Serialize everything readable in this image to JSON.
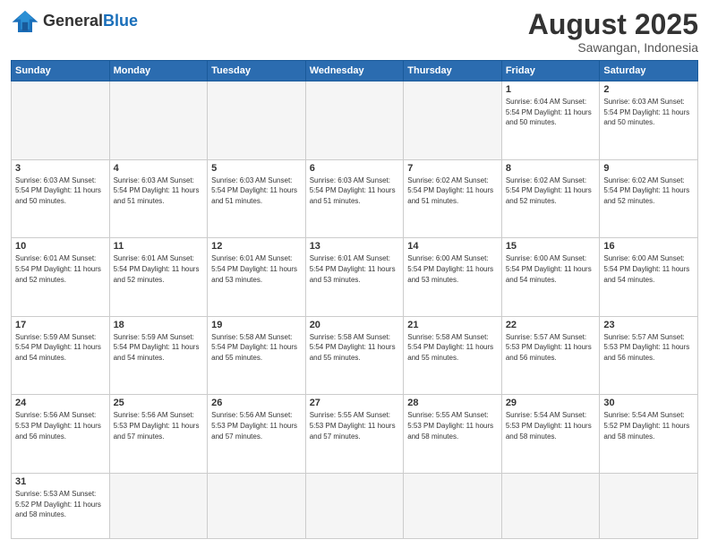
{
  "header": {
    "logo_general": "General",
    "logo_blue": "Blue",
    "month": "August 2025",
    "location": "Sawangan, Indonesia"
  },
  "days_of_week": [
    "Sunday",
    "Monday",
    "Tuesday",
    "Wednesday",
    "Thursday",
    "Friday",
    "Saturday"
  ],
  "weeks": [
    [
      {
        "day": "",
        "info": ""
      },
      {
        "day": "",
        "info": ""
      },
      {
        "day": "",
        "info": ""
      },
      {
        "day": "",
        "info": ""
      },
      {
        "day": "",
        "info": ""
      },
      {
        "day": "1",
        "info": "Sunrise: 6:04 AM\nSunset: 5:54 PM\nDaylight: 11 hours\nand 50 minutes."
      },
      {
        "day": "2",
        "info": "Sunrise: 6:03 AM\nSunset: 5:54 PM\nDaylight: 11 hours\nand 50 minutes."
      }
    ],
    [
      {
        "day": "3",
        "info": "Sunrise: 6:03 AM\nSunset: 5:54 PM\nDaylight: 11 hours\nand 50 minutes."
      },
      {
        "day": "4",
        "info": "Sunrise: 6:03 AM\nSunset: 5:54 PM\nDaylight: 11 hours\nand 51 minutes."
      },
      {
        "day": "5",
        "info": "Sunrise: 6:03 AM\nSunset: 5:54 PM\nDaylight: 11 hours\nand 51 minutes."
      },
      {
        "day": "6",
        "info": "Sunrise: 6:03 AM\nSunset: 5:54 PM\nDaylight: 11 hours\nand 51 minutes."
      },
      {
        "day": "7",
        "info": "Sunrise: 6:02 AM\nSunset: 5:54 PM\nDaylight: 11 hours\nand 51 minutes."
      },
      {
        "day": "8",
        "info": "Sunrise: 6:02 AM\nSunset: 5:54 PM\nDaylight: 11 hours\nand 52 minutes."
      },
      {
        "day": "9",
        "info": "Sunrise: 6:02 AM\nSunset: 5:54 PM\nDaylight: 11 hours\nand 52 minutes."
      }
    ],
    [
      {
        "day": "10",
        "info": "Sunrise: 6:01 AM\nSunset: 5:54 PM\nDaylight: 11 hours\nand 52 minutes."
      },
      {
        "day": "11",
        "info": "Sunrise: 6:01 AM\nSunset: 5:54 PM\nDaylight: 11 hours\nand 52 minutes."
      },
      {
        "day": "12",
        "info": "Sunrise: 6:01 AM\nSunset: 5:54 PM\nDaylight: 11 hours\nand 53 minutes."
      },
      {
        "day": "13",
        "info": "Sunrise: 6:01 AM\nSunset: 5:54 PM\nDaylight: 11 hours\nand 53 minutes."
      },
      {
        "day": "14",
        "info": "Sunrise: 6:00 AM\nSunset: 5:54 PM\nDaylight: 11 hours\nand 53 minutes."
      },
      {
        "day": "15",
        "info": "Sunrise: 6:00 AM\nSunset: 5:54 PM\nDaylight: 11 hours\nand 54 minutes."
      },
      {
        "day": "16",
        "info": "Sunrise: 6:00 AM\nSunset: 5:54 PM\nDaylight: 11 hours\nand 54 minutes."
      }
    ],
    [
      {
        "day": "17",
        "info": "Sunrise: 5:59 AM\nSunset: 5:54 PM\nDaylight: 11 hours\nand 54 minutes."
      },
      {
        "day": "18",
        "info": "Sunrise: 5:59 AM\nSunset: 5:54 PM\nDaylight: 11 hours\nand 54 minutes."
      },
      {
        "day": "19",
        "info": "Sunrise: 5:58 AM\nSunset: 5:54 PM\nDaylight: 11 hours\nand 55 minutes."
      },
      {
        "day": "20",
        "info": "Sunrise: 5:58 AM\nSunset: 5:54 PM\nDaylight: 11 hours\nand 55 minutes."
      },
      {
        "day": "21",
        "info": "Sunrise: 5:58 AM\nSunset: 5:54 PM\nDaylight: 11 hours\nand 55 minutes."
      },
      {
        "day": "22",
        "info": "Sunrise: 5:57 AM\nSunset: 5:53 PM\nDaylight: 11 hours\nand 56 minutes."
      },
      {
        "day": "23",
        "info": "Sunrise: 5:57 AM\nSunset: 5:53 PM\nDaylight: 11 hours\nand 56 minutes."
      }
    ],
    [
      {
        "day": "24",
        "info": "Sunrise: 5:56 AM\nSunset: 5:53 PM\nDaylight: 11 hours\nand 56 minutes."
      },
      {
        "day": "25",
        "info": "Sunrise: 5:56 AM\nSunset: 5:53 PM\nDaylight: 11 hours\nand 57 minutes."
      },
      {
        "day": "26",
        "info": "Sunrise: 5:56 AM\nSunset: 5:53 PM\nDaylight: 11 hours\nand 57 minutes."
      },
      {
        "day": "27",
        "info": "Sunrise: 5:55 AM\nSunset: 5:53 PM\nDaylight: 11 hours\nand 57 minutes."
      },
      {
        "day": "28",
        "info": "Sunrise: 5:55 AM\nSunset: 5:53 PM\nDaylight: 11 hours\nand 58 minutes."
      },
      {
        "day": "29",
        "info": "Sunrise: 5:54 AM\nSunset: 5:53 PM\nDaylight: 11 hours\nand 58 minutes."
      },
      {
        "day": "30",
        "info": "Sunrise: 5:54 AM\nSunset: 5:52 PM\nDaylight: 11 hours\nand 58 minutes."
      }
    ],
    [
      {
        "day": "31",
        "info": "Sunrise: 5:53 AM\nSunset: 5:52 PM\nDaylight: 11 hours\nand 58 minutes."
      },
      {
        "day": "",
        "info": ""
      },
      {
        "day": "",
        "info": ""
      },
      {
        "day": "",
        "info": ""
      },
      {
        "day": "",
        "info": ""
      },
      {
        "day": "",
        "info": ""
      },
      {
        "day": "",
        "info": ""
      }
    ]
  ]
}
